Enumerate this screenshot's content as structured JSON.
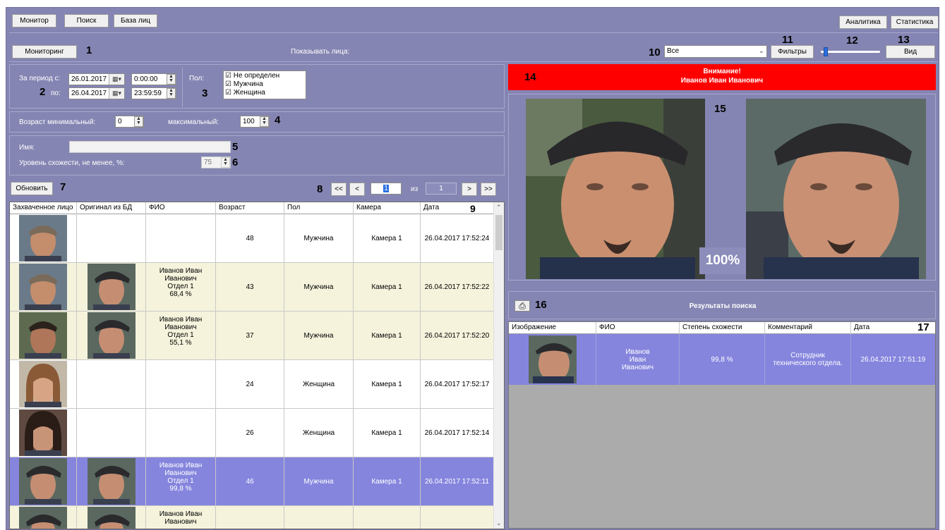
{
  "top_tabs": [
    "Монитор",
    "Поиск",
    "База лиц"
  ],
  "top_right_buttons": [
    "Аналитика",
    "Статистика"
  ],
  "toolbar": {
    "monitoring_button": "Мониторинг",
    "show_faces_label": "Показывать лица:",
    "filter_select_value": "Все",
    "filters_button": "Фильтры",
    "view_button": "Вид",
    "slider_level_percent": 5
  },
  "period": {
    "from_label": "За период с:",
    "to_label": "по:",
    "from_date": "26.01.2017",
    "from_time": "0:00:00",
    "to_date": "26.04.2017",
    "to_time": "23:59:59"
  },
  "gender": {
    "label": "Пол:",
    "options": [
      {
        "label": "Не определен",
        "checked": true
      },
      {
        "label": "Мужчина",
        "checked": true
      },
      {
        "label": "Женщина",
        "checked": true
      }
    ]
  },
  "age": {
    "min_label": "Возраст минимальный:",
    "min_value": "0",
    "max_label": "максимальный:",
    "max_value": "100"
  },
  "name_filter": {
    "label": "Имя:",
    "value": ""
  },
  "similarity": {
    "label": "Уровень схожести, не менее, %:",
    "value": "75"
  },
  "refresh_button": "Обновить",
  "pager": {
    "first": "<<",
    "prev": "<",
    "current": "1",
    "of_label": "из",
    "total": "1",
    "next": ">",
    "last": ">>"
  },
  "table": {
    "columns": [
      "Захваченное лицо",
      "Оригинал из БД",
      "ФИО",
      "Возраст",
      "Пол",
      "Камера",
      "Дата"
    ],
    "rows": [
      {
        "fio": "",
        "age": "48",
        "gender": "Мужчина",
        "camera": "Камера 1",
        "date": "26.04.2017 17:52:24",
        "has_db": false,
        "face": "older-man",
        "selected": false,
        "highlight": false
      },
      {
        "fio": "Иванов Иван\nИванович\nОтдел 1\n68,4 %",
        "age": "43",
        "gender": "Мужчина",
        "camera": "Камера 1",
        "date": "26.04.2017 17:52:22",
        "has_db": true,
        "face": "older-man",
        "selected": false,
        "highlight": true
      },
      {
        "fio": "Иванов Иван\nИванович\nОтдел 1\n55,1 %",
        "age": "37",
        "gender": "Мужчина",
        "camera": "Камера 1",
        "date": "26.04.2017 17:52:20",
        "has_db": true,
        "face": "dark-man",
        "selected": false,
        "highlight": true
      },
      {
        "fio": "",
        "age": "24",
        "gender": "Женщина",
        "camera": "Камера 1",
        "date": "26.04.2017 17:52:17",
        "has_db": false,
        "face": "woman-light",
        "selected": false,
        "highlight": false
      },
      {
        "fio": "",
        "age": "26",
        "gender": "Женщина",
        "camera": "Камера 1",
        "date": "26.04.2017 17:52:14",
        "has_db": false,
        "face": "woman-dark",
        "selected": false,
        "highlight": false
      },
      {
        "fio": "Иванов Иван\nИванович\nОтдел 1\n99,8 %",
        "age": "46",
        "gender": "Мужчина",
        "camera": "Камера 1",
        "date": "26.04.2017 17:52:11",
        "has_db": true,
        "face": "cap-man",
        "selected": true,
        "highlight": false
      },
      {
        "fio": "Иванов Иван\nИванович",
        "age": "",
        "gender": "",
        "camera": "",
        "date": "",
        "has_db": true,
        "face": "cap-man",
        "selected": false,
        "highlight": true
      }
    ]
  },
  "alert": {
    "line1": "Внимание!",
    "line2": "Иванов Иван Иванович",
    "color": "#ff0000"
  },
  "comparison": {
    "score": "100%"
  },
  "results": {
    "title": "Результаты поиска",
    "columns": [
      "Изображение",
      "ФИО",
      "Степень схожести",
      "Комментарий",
      "Дата"
    ],
    "rows": [
      {
        "fio": "Иванов\nИван\nИванович",
        "similarity": "99,8 %",
        "comment": "Сотрудник технического отдела.",
        "date": "26.04.2017 17:51:19"
      }
    ]
  },
  "callouts": [
    "1",
    "2",
    "3",
    "4",
    "5",
    "6",
    "7",
    "8",
    "9",
    "10",
    "11",
    "12",
    "13",
    "14",
    "15",
    "16",
    "17"
  ],
  "colors": {
    "panel": "#8585b3",
    "selected_row": "#8585de",
    "highlight_row": "#f5f3dc",
    "alert_red": "#ff0000"
  },
  "icons": [
    "calendar-icon",
    "spin-icon",
    "dropdown-arrow-icon",
    "printer-icon",
    "checkbox-icon",
    "scroll-arrow-icon"
  ]
}
